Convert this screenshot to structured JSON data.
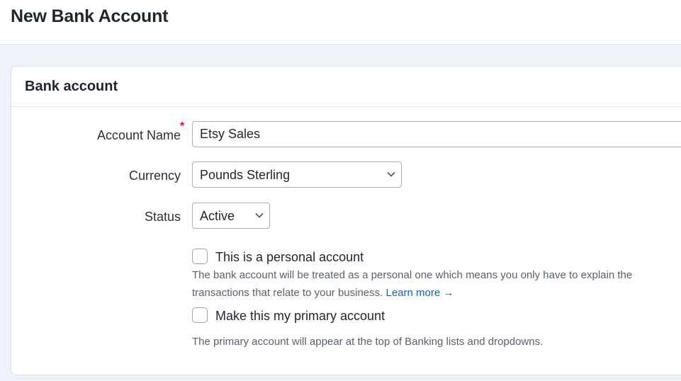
{
  "header": {
    "title": "New Bank Account"
  },
  "card": {
    "title": "Bank account"
  },
  "form": {
    "account_name": {
      "label": "Account Name",
      "required_mark": "*",
      "value": "Etsy Sales"
    },
    "currency": {
      "label": "Currency",
      "value": "Pounds Sterling"
    },
    "status": {
      "label": "Status",
      "value": "Active"
    },
    "personal": {
      "label": "This is a personal account",
      "checked": false,
      "help_line1": "The bank account will be treated as a personal one which means you only have to explain the",
      "help_line2": "transactions that relate to your business.",
      "learn_more": "Learn more →"
    },
    "primary": {
      "label": "Make this my primary account",
      "checked": false,
      "help": "The primary account will appear at the top of Banking lists and dropdowns."
    }
  },
  "colors": {
    "accent_link": "#0b62c4",
    "required": "#c8102e",
    "page_bg": "#eef3fa"
  }
}
